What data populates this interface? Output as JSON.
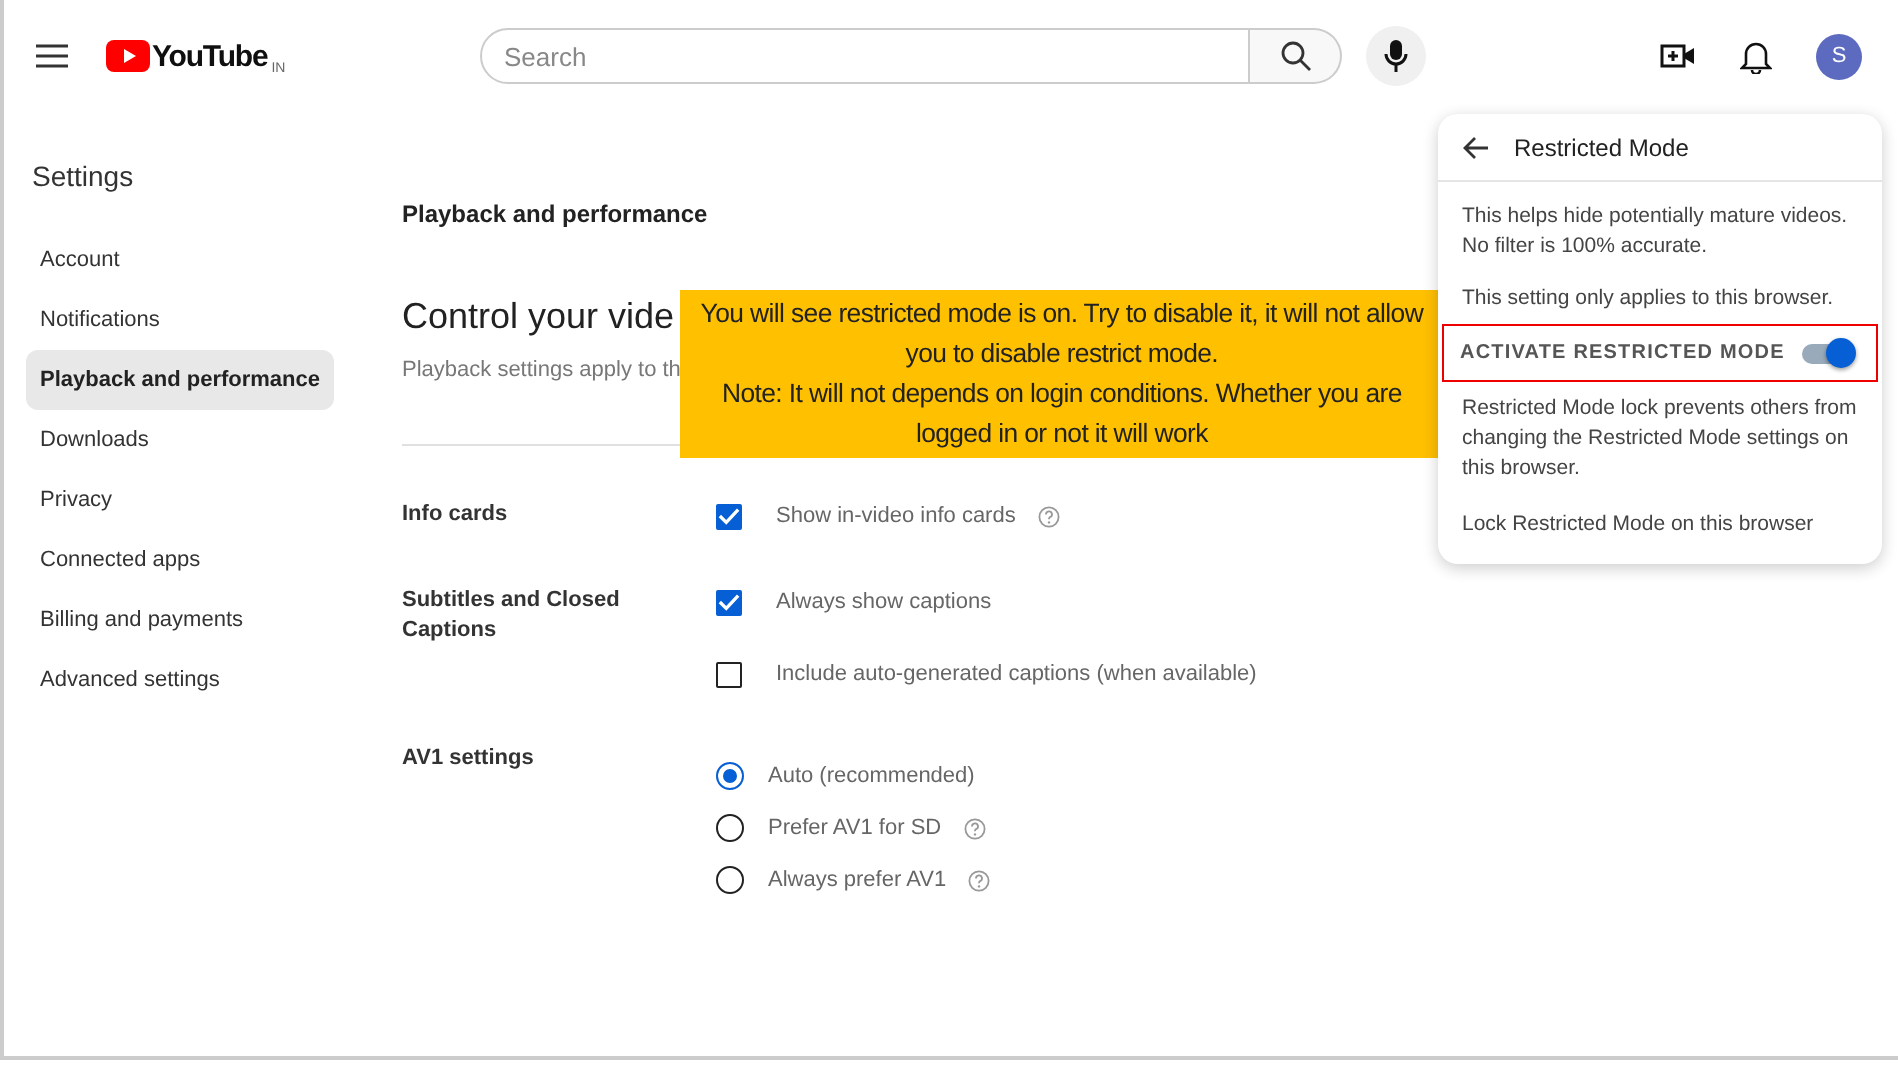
{
  "header": {
    "logo_text": "YouTube",
    "region": "IN",
    "search": {
      "placeholder": "Search"
    },
    "avatar": "S"
  },
  "sidebar": {
    "title": "Settings",
    "items": [
      {
        "label": "Account",
        "selected": false
      },
      {
        "label": "Notifications",
        "selected": false
      },
      {
        "label": "Playback and performance",
        "selected": true
      },
      {
        "label": "Downloads",
        "selected": false
      },
      {
        "label": "Privacy",
        "selected": false
      },
      {
        "label": "Connected apps",
        "selected": false
      },
      {
        "label": "Billing and payments",
        "selected": false
      },
      {
        "label": "Advanced settings",
        "selected": false
      }
    ]
  },
  "main": {
    "section_title": "Playback and performance",
    "heading": "Control your vide",
    "subtitle": "Playback settings apply to th",
    "groups": [
      {
        "label": "Info cards",
        "options": [
          {
            "kind": "checkbox",
            "label": "Show in-video info cards",
            "checked": true,
            "help": true
          }
        ]
      },
      {
        "label": "Subtitles and Closed Captions",
        "options": [
          {
            "kind": "checkbox",
            "label": "Always show captions",
            "checked": true,
            "help": false
          },
          {
            "kind": "checkbox",
            "label": "Include auto-generated captions (when available)",
            "checked": false,
            "help": false
          }
        ]
      },
      {
        "label": "AV1 settings",
        "options": [
          {
            "kind": "radio",
            "label": "Auto (recommended)",
            "selected": true,
            "help": false
          },
          {
            "kind": "radio",
            "label": "Prefer AV1 for SD",
            "selected": false,
            "help": true
          },
          {
            "kind": "radio",
            "label": "Always prefer AV1",
            "selected": false,
            "help": true
          }
        ]
      }
    ]
  },
  "annotation": {
    "lines": [
      "You will see restricted mode is on. Try to disable it, it will not allow you to disable restrict mode.",
      "Note: It will not depends on login conditions. Whether you are logged in or not it will work"
    ]
  },
  "popup": {
    "title": "Restricted Mode",
    "paragraphs": [
      "This helps hide potentially mature videos. No filter is 100% accurate.",
      "This setting only applies to this browser."
    ],
    "toggle": {
      "label": "ACTIVATE RESTRICTED MODE",
      "on": true,
      "highlighted": true
    },
    "lock_text": "Restricted Mode lock prevents others from changing the Restricted Mode settings on this browser.",
    "lock_link": "Lock Restricted Mode on this browser"
  }
}
